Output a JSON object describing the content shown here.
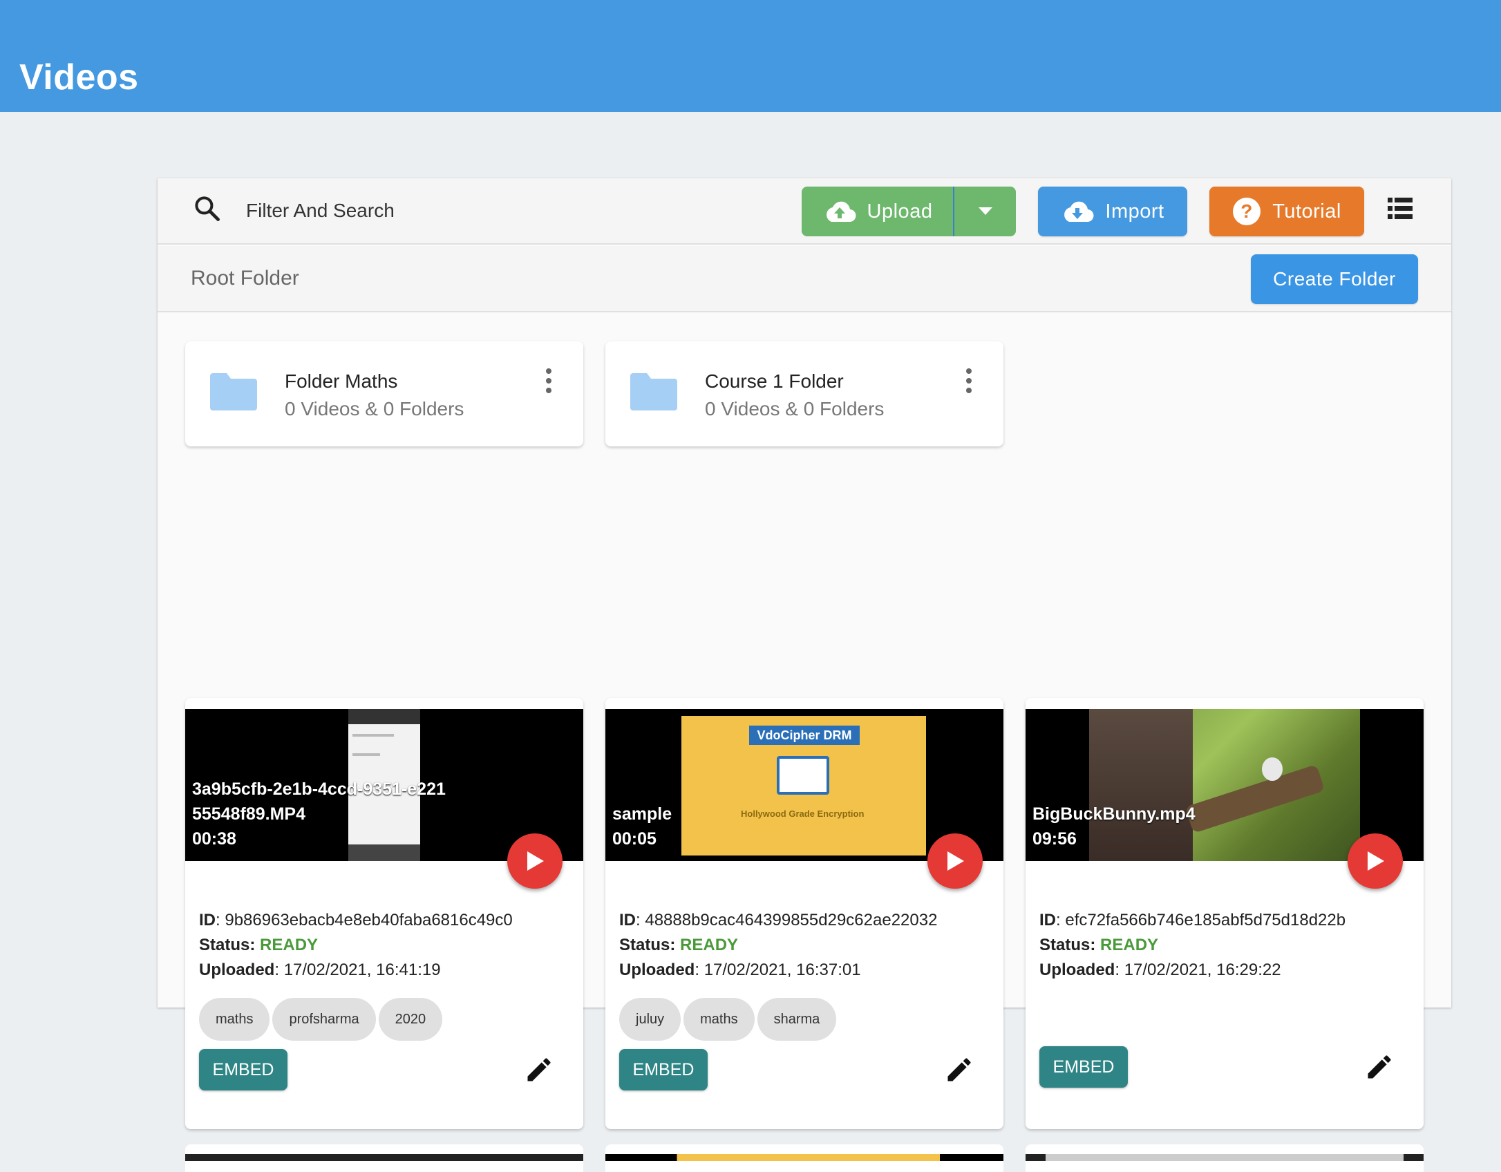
{
  "header": {
    "title": "Videos"
  },
  "toolbar": {
    "search_placeholder": "Filter And Search",
    "upload_label": "Upload",
    "import_label": "Import",
    "tutorial_label": "Tutorial"
  },
  "breadcrumb": {
    "current": "Root Folder",
    "create_folder_label": "Create Folder"
  },
  "folders": [
    {
      "name": "Folder Maths",
      "meta": "0 Videos & 0 Folders"
    },
    {
      "name": "Course 1 Folder",
      "meta": "0 Videos & 0 Folders"
    }
  ],
  "videos": [
    {
      "title": "3a9b5cfb-2e1b-4ccd-9351-e221\n55548f89.MP4\n00:38",
      "id_label": "ID",
      "id": "9b86963ebacb4e8eb40faba6816c49c0",
      "status_label": "Status:",
      "status": "READY",
      "uploaded_label": "Uploaded",
      "uploaded": "17/02/2021, 16:41:19",
      "tags": [
        "maths",
        "profsharma",
        "2020"
      ],
      "embed_label": "EMBED"
    },
    {
      "title": "sample\n00:05",
      "thumb_text": "VdoCipher DRM",
      "thumb_subtext": "Hollywood Grade Encryption",
      "id_label": "ID",
      "id": "48888b9cac464399855d29c62ae22032",
      "status_label": "Status:",
      "status": "READY",
      "uploaded_label": "Uploaded",
      "uploaded": "17/02/2021, 16:37:01",
      "tags": [
        "juluy",
        "maths",
        "sharma"
      ],
      "embed_label": "EMBED"
    },
    {
      "title": "BigBuckBunny.mp4\n09:56",
      "id_label": "ID",
      "id": "efc72fa566b746e185abf5d75d18d22b",
      "status_label": "Status:",
      "status": "READY",
      "uploaded_label": "Uploaded",
      "uploaded": "17/02/2021, 16:29:22",
      "tags": [],
      "embed_label": "EMBED"
    }
  ],
  "colors": {
    "header": "#4499e0",
    "upload": "#6db86d",
    "import": "#4499e0",
    "tutorial": "#e67a2a",
    "embed": "#2f8585",
    "play": "#e53935",
    "ready": "#4a9a3a"
  }
}
